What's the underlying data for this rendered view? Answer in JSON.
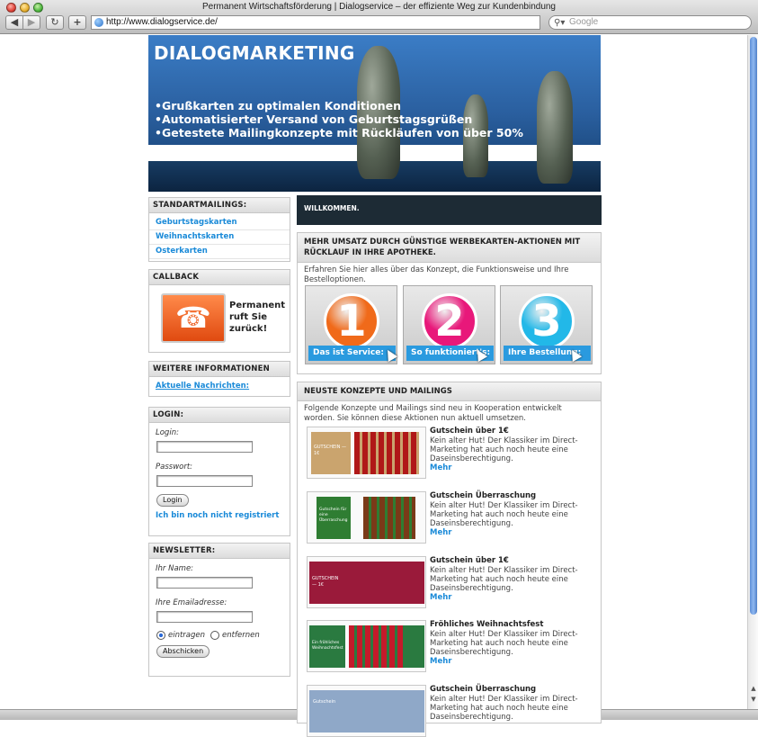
{
  "browser": {
    "title": "Permanent Wirtschaftsförderung | Dialogservice – der effiziente Weg zur Kundenbindung",
    "url": "http://www.dialogservice.de/",
    "search_placeholder": "Google"
  },
  "banner": {
    "title": "DIALOGMARKETING",
    "bullets": [
      "Grußkarten zu optimalen Konditionen",
      "Automatisierter Versand von Geburtstagsgrüßen",
      "Getestete Mailingkonzepte mit Rückläufen von über 50%"
    ]
  },
  "sidebar": {
    "standard": {
      "title": "STANDARTMAILINGS:",
      "links": [
        "Geburtstagskarten",
        "Weihnachtskarten",
        "Osterkarten"
      ]
    },
    "callback": {
      "title": "CALLBACK",
      "text": [
        "Permanent",
        "ruft Sie",
        "zurück!"
      ]
    },
    "info": {
      "title": "WEITERE INFORMATIONEN",
      "link": "Aktuelle Nachrichten:"
    },
    "login": {
      "title": "LOGIN:",
      "login_label": "Login:",
      "password_label": "Passwort:",
      "button": "Login",
      "register_link": "Ich bin noch nicht registriert"
    },
    "newsletter": {
      "title": "NEWSLETTER:",
      "name_label": "Ihr Name:",
      "email_label": "Ihre Emailadresse:",
      "option_subscribe": "eintragen",
      "option_unsubscribe": "entfernen",
      "button": "Abschicken"
    }
  },
  "main": {
    "welcome": "WILLKOMMEN.",
    "promo": {
      "title": "MEHR UMSATZ DURCH GÜNSTIGE WERBEKARTEN-AKTIONEN MIT RÜCKLAUF IN IHRE APOTHEKE.",
      "intro": "Erfahren Sie hier alles über das Konzept, die Funktionsweise und Ihre Bestelloptionen.",
      "tiles": [
        {
          "number": "1",
          "label": "Das ist Service:",
          "color": "#f06a1a"
        },
        {
          "number": "2",
          "label": "So funktioniert's:",
          "color": "#e8187a"
        },
        {
          "number": "3",
          "label": "Ihre Bestellung:",
          "color": "#22b8e8"
        }
      ]
    },
    "concepts": {
      "title": "NEUSTE KONZEPTE UND MAILINGS",
      "intro": "Folgende Konzepte und Mailings sind neu in Kooperation entwickelt worden. Sie können diese Aktionen nun aktuell umsetzen.",
      "more_label": "Mehr",
      "items": [
        {
          "title": "Gutschein über 1€",
          "text": "Kein alter Hut! Der Klassiker im Direct-Marketing hat auch noch heute eine Daseinsberechtigung.",
          "card_text": "GUTSCHEIN — 1€",
          "card_color": "#caa46e",
          "accent": "#b01818"
        },
        {
          "title": "Gutschein Überraschung",
          "text": "Kein alter Hut! Der Klassiker im Direct-Marketing hat auch noch heute eine Daseinsberechtigung.",
          "card_text": "Gutschein für eine Überraschung",
          "card_color": "#2f7d32",
          "accent": "#7a3a18"
        },
        {
          "title": "Gutschein über 1€",
          "text": "Kein alter Hut! Der Klassiker im Direct-Marketing hat auch noch heute eine Daseinsberechtigung.",
          "card_text": "GUTSCHEIN — 1€",
          "card_color": "#9a1a3a",
          "accent": "#f0b040"
        },
        {
          "title": "Fröhliches Weihnachtsfest",
          "text": "Kein alter Hut! Der Klassiker im Direct-Marketing hat auch noch heute eine Daseinsberechtigung.",
          "card_text": "Ein fröhliches Weihnachtsfest",
          "card_color": "#2a7a40",
          "accent": "#c41a2a"
        },
        {
          "title": "Gutschein Überraschung",
          "text": "Kein alter Hut! Der Klassiker im Direct-Marketing hat auch noch heute eine Daseinsberechtigung.",
          "card_text": "Gutschein",
          "card_color": "#8fa8c8",
          "accent": "#dfe8f0"
        }
      ]
    }
  }
}
